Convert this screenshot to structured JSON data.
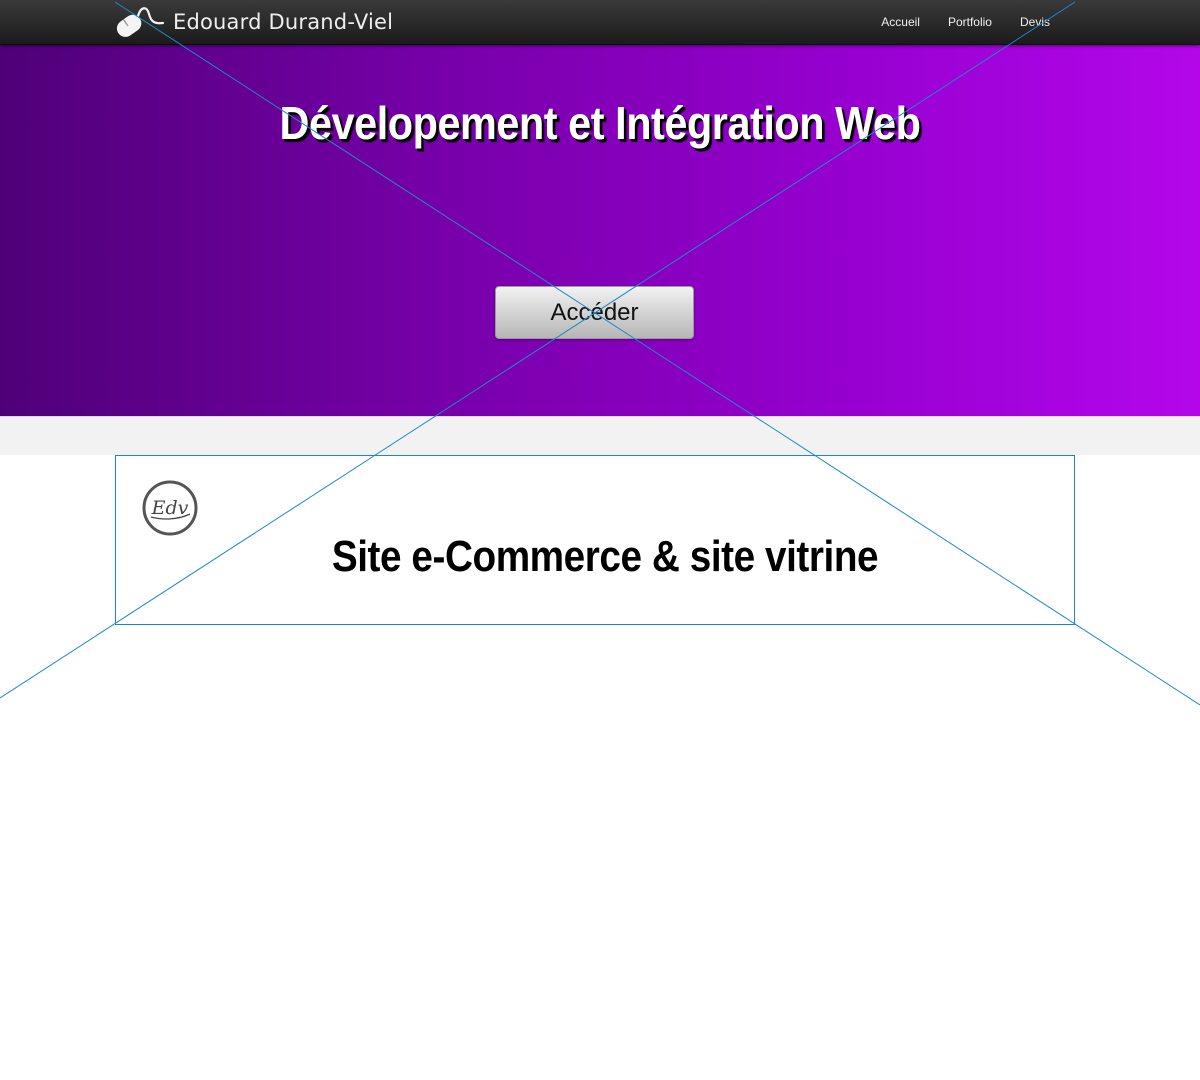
{
  "header": {
    "brand_name": "Edouard Durand-Viel",
    "brand_logo_icon": "mouse-icon",
    "nav": [
      "Accueil",
      "Portfolio",
      "Devis"
    ]
  },
  "hero": {
    "title": "Dévelopement et Intégration Web",
    "button_label": "Accéder"
  },
  "section": {
    "logo_text": "Edv",
    "title": "Site e-Commerce & site vitrine"
  },
  "colors": {
    "navbar": "#222222",
    "hero_gradient_start": "#4f0078",
    "hero_gradient_end": "#b307ea",
    "box_border": "#1e88c6",
    "overlay_lines": "#1e88c6"
  }
}
